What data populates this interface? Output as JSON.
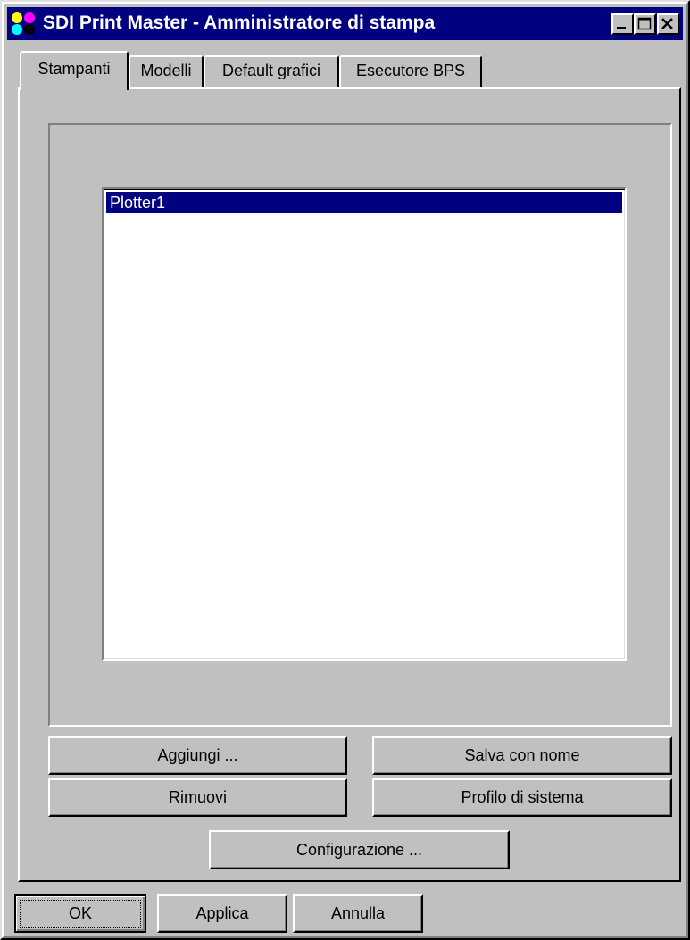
{
  "window": {
    "title": "SDI Print Master - Amministratore di stampa"
  },
  "tabs": [
    {
      "label": "Stampanti",
      "active": true
    },
    {
      "label": "Modelli",
      "active": false
    },
    {
      "label": "Default grafici",
      "active": false
    },
    {
      "label": "Esecutore BPS",
      "active": false
    }
  ],
  "printers": {
    "items": [
      "Plotter1"
    ],
    "selected": "Plotter1"
  },
  "actions": {
    "add": "Aggiungi ...",
    "save_as": "Salva con nome",
    "remove": "Rimuovi",
    "system_profile": "Profilo di sistema",
    "configure": "Configurazione ..."
  },
  "dialog_buttons": {
    "ok": "OK",
    "apply": "Applica",
    "cancel": "Annulla"
  },
  "colors": {
    "titlebar": "#000080",
    "face": "#c0c0c0",
    "selection": "#000080"
  }
}
